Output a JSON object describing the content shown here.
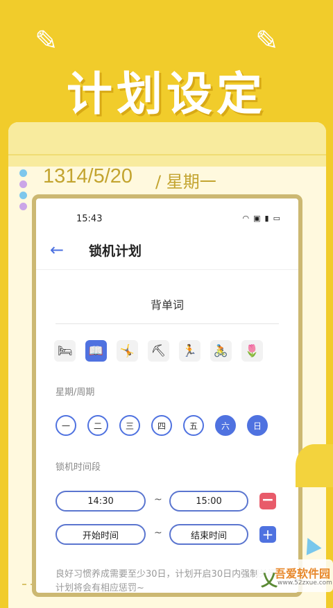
{
  "hero": {
    "title": "计划设定"
  },
  "notebook": {
    "date": "1314/5/20",
    "weekday": "/ 星期一",
    "dot_colors": [
      "#7ec7ec",
      "#cba5e8",
      "#7ec7ec",
      "#cba5e8"
    ]
  },
  "status_bar": {
    "time": "15:43",
    "icons": [
      "wifi-icon",
      "hd-icon",
      "signal-icon",
      "battery-icon"
    ]
  },
  "app_bar": {
    "title": "锁机计划"
  },
  "plan": {
    "name": "背单词"
  },
  "activities": [
    {
      "icon": "sleep-icon",
      "glyph": "🛏",
      "selected": false
    },
    {
      "icon": "book-icon",
      "glyph": "📖",
      "selected": true
    },
    {
      "icon": "exercise-icon",
      "glyph": "🤸",
      "selected": false
    },
    {
      "icon": "work-icon",
      "glyph": "⛏",
      "selected": false
    },
    {
      "icon": "run-icon",
      "glyph": "🏃",
      "selected": false
    },
    {
      "icon": "cycling-icon",
      "glyph": "🚴",
      "selected": false
    },
    {
      "icon": "flower-icon",
      "glyph": "🌷",
      "selected": false
    }
  ],
  "week_section": {
    "label": "星期/周期"
  },
  "days": [
    {
      "label": "一",
      "on": false
    },
    {
      "label": "二",
      "on": false
    },
    {
      "label": "三",
      "on": false
    },
    {
      "label": "四",
      "on": false
    },
    {
      "label": "五",
      "on": false
    },
    {
      "label": "六",
      "on": true
    },
    {
      "label": "日",
      "on": true
    }
  ],
  "time_section": {
    "label": "锁机时间段",
    "range1": {
      "start": "14:30",
      "end": "15:00"
    },
    "range2": {
      "start": "开始时间",
      "end": "结束时间"
    },
    "separator": "~"
  },
  "tip": "良好习惯养成需要至少30日，计划开启30日内强制关闭计划将会有相应惩罚~",
  "watermark": {
    "title": "吾爱软件园",
    "url": "www.52zxue.com"
  },
  "colors": {
    "background": "#f1cc2b",
    "accent": "#4f72e0",
    "danger": "#e85b6a"
  }
}
